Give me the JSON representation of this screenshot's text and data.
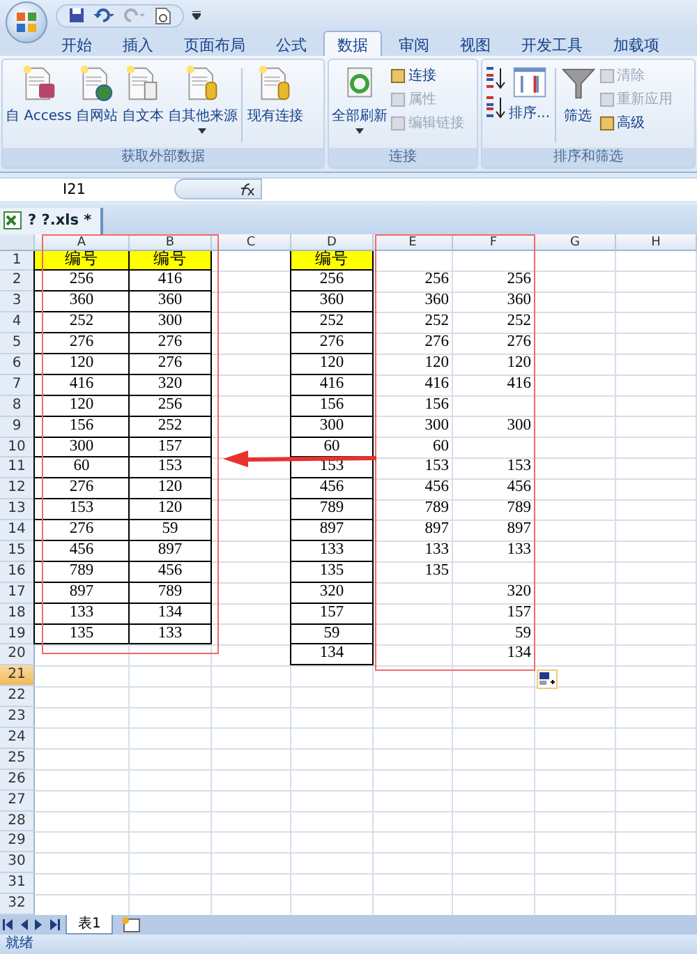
{
  "ribbon_tabs": [
    {
      "label": "开始",
      "selected": false
    },
    {
      "label": "插入",
      "selected": false
    },
    {
      "label": "页面布局",
      "selected": false
    },
    {
      "label": "公式",
      "selected": false
    },
    {
      "label": "数据",
      "selected": true
    },
    {
      "label": "审阅",
      "selected": false
    },
    {
      "label": "视图",
      "selected": false
    },
    {
      "label": "开发工具",
      "selected": false
    },
    {
      "label": "加载项",
      "selected": false
    }
  ],
  "ribbon_groups": [
    {
      "title": "获取外部数据",
      "items": [
        {
          "kind": "large",
          "label": "自 Access",
          "menu": false
        },
        {
          "kind": "large",
          "label": "自网站",
          "menu": false
        },
        {
          "kind": "large",
          "label": "自文本",
          "menu": false
        },
        {
          "kind": "large",
          "label": "自其他来源",
          "menu": true
        },
        {
          "kind": "separator"
        },
        {
          "kind": "large",
          "label": "现有连接",
          "menu": false
        }
      ]
    },
    {
      "title": "连接",
      "items": [
        {
          "kind": "large",
          "label": "全部刷新",
          "menu": true
        },
        {
          "kind": "small",
          "label": "连接",
          "disabled": false
        },
        {
          "kind": "small",
          "label": "属性",
          "disabled": true
        },
        {
          "kind": "small",
          "label": "编辑链接",
          "disabled": true
        }
      ]
    },
    {
      "title": "排序和筛选",
      "items": [
        {
          "kind": "sort"
        },
        {
          "kind": "sort"
        },
        {
          "kind": "large",
          "label": "排序...",
          "menu": false
        },
        {
          "kind": "separator"
        },
        {
          "kind": "large",
          "label": "筛选",
          "menu": false
        },
        {
          "kind": "small",
          "label": "清除",
          "disabled": true
        },
        {
          "kind": "small",
          "label": "重新应用",
          "disabled": true
        },
        {
          "kind": "small",
          "label": "高级",
          "disabled": false
        }
      ]
    }
  ],
  "name_box": "I21",
  "workbook_tab": "? ?.xls *",
  "columns": [
    "A",
    "B",
    "C",
    "D",
    "E",
    "F",
    "G",
    "H"
  ],
  "rows": [
    {
      "number": "1",
      "active": false,
      "cells": {
        "A": {
          "value": "编号",
          "kind": "header",
          "boxed": true
        },
        "B": {
          "value": "编号",
          "kind": "header",
          "boxed": true
        },
        "D": {
          "value": "编号",
          "kind": "header",
          "boxed": true
        }
      }
    },
    {
      "number": "2",
      "active": false,
      "cells": {
        "A": {
          "value": "256",
          "kind": "number",
          "boxed": true
        },
        "B": {
          "value": "416",
          "kind": "number",
          "boxed": true
        },
        "D": {
          "value": "256",
          "kind": "number",
          "boxed": true
        },
        "E": {
          "value": "256",
          "kind": "number",
          "boxed": false
        },
        "F": {
          "value": "256",
          "kind": "number",
          "boxed": false
        }
      }
    },
    {
      "number": "3",
      "active": false,
      "cells": {
        "A": {
          "value": "360",
          "kind": "number",
          "boxed": true
        },
        "B": {
          "value": "360",
          "kind": "number",
          "boxed": true
        },
        "D": {
          "value": "360",
          "kind": "number",
          "boxed": true
        },
        "E": {
          "value": "360",
          "kind": "number",
          "boxed": false
        },
        "F": {
          "value": "360",
          "kind": "number",
          "boxed": false
        }
      }
    },
    {
      "number": "4",
      "active": false,
      "cells": {
        "A": {
          "value": "252",
          "kind": "number",
          "boxed": true
        },
        "B": {
          "value": "300",
          "kind": "number",
          "boxed": true
        },
        "D": {
          "value": "252",
          "kind": "number",
          "boxed": true
        },
        "E": {
          "value": "252",
          "kind": "number",
          "boxed": false
        },
        "F": {
          "value": "252",
          "kind": "number",
          "boxed": false
        }
      }
    },
    {
      "number": "5",
      "active": false,
      "cells": {
        "A": {
          "value": "276",
          "kind": "number",
          "boxed": true
        },
        "B": {
          "value": "276",
          "kind": "number",
          "boxed": true
        },
        "D": {
          "value": "276",
          "kind": "number",
          "boxed": true
        },
        "E": {
          "value": "276",
          "kind": "number",
          "boxed": false
        },
        "F": {
          "value": "276",
          "kind": "number",
          "boxed": false
        }
      }
    },
    {
      "number": "6",
      "active": false,
      "cells": {
        "A": {
          "value": "120",
          "kind": "number",
          "boxed": true
        },
        "B": {
          "value": "276",
          "kind": "number",
          "boxed": true
        },
        "D": {
          "value": "120",
          "kind": "number",
          "boxed": true
        },
        "E": {
          "value": "120",
          "kind": "number",
          "boxed": false
        },
        "F": {
          "value": "120",
          "kind": "number",
          "boxed": false
        }
      }
    },
    {
      "number": "7",
      "active": false,
      "cells": {
        "A": {
          "value": "416",
          "kind": "number",
          "boxed": true
        },
        "B": {
          "value": "320",
          "kind": "number",
          "boxed": true
        },
        "D": {
          "value": "416",
          "kind": "number",
          "boxed": true
        },
        "E": {
          "value": "416",
          "kind": "number",
          "boxed": false
        },
        "F": {
          "value": "416",
          "kind": "number",
          "boxed": false
        }
      }
    },
    {
      "number": "8",
      "active": false,
      "cells": {
        "A": {
          "value": "120",
          "kind": "number",
          "boxed": true
        },
        "B": {
          "value": "256",
          "kind": "number",
          "boxed": true
        },
        "D": {
          "value": "156",
          "kind": "number",
          "boxed": true
        },
        "E": {
          "value": "156",
          "kind": "number",
          "boxed": false
        }
      }
    },
    {
      "number": "9",
      "active": false,
      "cells": {
        "A": {
          "value": "156",
          "kind": "number",
          "boxed": true
        },
        "B": {
          "value": "252",
          "kind": "number",
          "boxed": true
        },
        "D": {
          "value": "300",
          "kind": "number",
          "boxed": true
        },
        "E": {
          "value": "300",
          "kind": "number",
          "boxed": false
        },
        "F": {
          "value": "300",
          "kind": "number",
          "boxed": false
        }
      }
    },
    {
      "number": "10",
      "active": false,
      "cells": {
        "A": {
          "value": "300",
          "kind": "number",
          "boxed": true
        },
        "B": {
          "value": "157",
          "kind": "number",
          "boxed": true
        },
        "D": {
          "value": "60",
          "kind": "number",
          "boxed": true
        },
        "E": {
          "value": "60",
          "kind": "number",
          "boxed": false
        }
      }
    },
    {
      "number": "11",
      "active": false,
      "cells": {
        "A": {
          "value": "60",
          "kind": "number",
          "boxed": true
        },
        "B": {
          "value": "153",
          "kind": "number",
          "boxed": true
        },
        "D": {
          "value": "153",
          "kind": "number",
          "boxed": true
        },
        "E": {
          "value": "153",
          "kind": "number",
          "boxed": false
        },
        "F": {
          "value": "153",
          "kind": "number",
          "boxed": false
        }
      }
    },
    {
      "number": "12",
      "active": false,
      "cells": {
        "A": {
          "value": "276",
          "kind": "number",
          "boxed": true
        },
        "B": {
          "value": "120",
          "kind": "number",
          "boxed": true
        },
        "D": {
          "value": "456",
          "kind": "number",
          "boxed": true
        },
        "E": {
          "value": "456",
          "kind": "number",
          "boxed": false
        },
        "F": {
          "value": "456",
          "kind": "number",
          "boxed": false
        }
      }
    },
    {
      "number": "13",
      "active": false,
      "cells": {
        "A": {
          "value": "153",
          "kind": "number",
          "boxed": true
        },
        "B": {
          "value": "120",
          "kind": "number",
          "boxed": true
        },
        "D": {
          "value": "789",
          "kind": "number",
          "boxed": true
        },
        "E": {
          "value": "789",
          "kind": "number",
          "boxed": false
        },
        "F": {
          "value": "789",
          "kind": "number",
          "boxed": false
        }
      }
    },
    {
      "number": "14",
      "active": false,
      "cells": {
        "A": {
          "value": "276",
          "kind": "number",
          "boxed": true
        },
        "B": {
          "value": "59",
          "kind": "number",
          "boxed": true
        },
        "D": {
          "value": "897",
          "kind": "number",
          "boxed": true
        },
        "E": {
          "value": "897",
          "kind": "number",
          "boxed": false
        },
        "F": {
          "value": "897",
          "kind": "number",
          "boxed": false
        }
      }
    },
    {
      "number": "15",
      "active": false,
      "cells": {
        "A": {
          "value": "456",
          "kind": "number",
          "boxed": true
        },
        "B": {
          "value": "897",
          "kind": "number",
          "boxed": true
        },
        "D": {
          "value": "133",
          "kind": "number",
          "boxed": true
        },
        "E": {
          "value": "133",
          "kind": "number",
          "boxed": false
        },
        "F": {
          "value": "133",
          "kind": "number",
          "boxed": false
        }
      }
    },
    {
      "number": "16",
      "active": false,
      "cells": {
        "A": {
          "value": "789",
          "kind": "number",
          "boxed": true
        },
        "B": {
          "value": "456",
          "kind": "number",
          "boxed": true
        },
        "D": {
          "value": "135",
          "kind": "number",
          "boxed": true
        },
        "E": {
          "value": "135",
          "kind": "number",
          "boxed": false
        }
      }
    },
    {
      "number": "17",
      "active": false,
      "cells": {
        "A": {
          "value": "897",
          "kind": "number",
          "boxed": true
        },
        "B": {
          "value": "789",
          "kind": "number",
          "boxed": true
        },
        "D": {
          "value": "320",
          "kind": "number",
          "boxed": true
        },
        "F": {
          "value": "320",
          "kind": "number",
          "boxed": false
        }
      }
    },
    {
      "number": "18",
      "active": false,
      "cells": {
        "A": {
          "value": "133",
          "kind": "number",
          "boxed": true
        },
        "B": {
          "value": "134",
          "kind": "number",
          "boxed": true
        },
        "D": {
          "value": "157",
          "kind": "number",
          "boxed": true
        },
        "F": {
          "value": "157",
          "kind": "number",
          "boxed": false
        }
      }
    },
    {
      "number": "19",
      "active": false,
      "cells": {
        "A": {
          "value": "135",
          "kind": "number",
          "boxed": true
        },
        "B": {
          "value": "133",
          "kind": "number",
          "boxed": true
        },
        "D": {
          "value": "59",
          "kind": "number",
          "boxed": true
        },
        "F": {
          "value": "59",
          "kind": "number",
          "boxed": false
        }
      }
    },
    {
      "number": "20",
      "active": false,
      "cells": {
        "D": {
          "value": "134",
          "kind": "number",
          "boxed": true
        },
        "F": {
          "value": "134",
          "kind": "number",
          "boxed": false
        }
      }
    },
    {
      "number": "21",
      "active": true
    },
    {
      "number": "22",
      "active": false
    },
    {
      "number": "23",
      "active": false
    },
    {
      "number": "24",
      "active": false
    },
    {
      "number": "25",
      "active": false
    },
    {
      "number": "26",
      "active": false
    },
    {
      "number": "27",
      "active": false
    },
    {
      "number": "28",
      "active": false
    },
    {
      "number": "29",
      "active": false
    },
    {
      "number": "30",
      "active": false
    },
    {
      "number": "31",
      "active": false
    },
    {
      "number": "32",
      "active": false
    }
  ],
  "sheet_tabs": [
    {
      "label": "表1",
      "selected": true
    }
  ],
  "status_bar": "就绪"
}
